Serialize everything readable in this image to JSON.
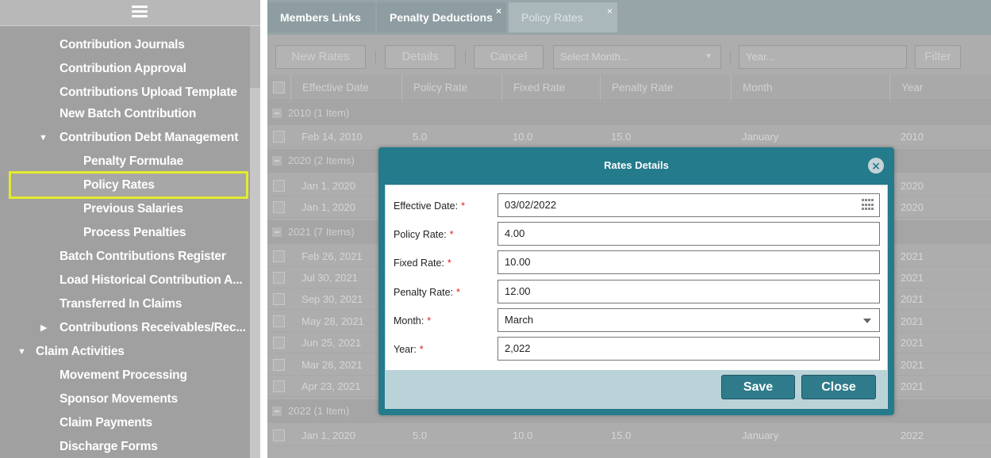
{
  "sidebar": {
    "items": [
      {
        "label": "Contribution Journals"
      },
      {
        "label": "Contribution Approval"
      },
      {
        "label": "Contributions Upload Template"
      },
      {
        "label": "New Batch Contribution"
      },
      {
        "label": "Contribution Debt Management"
      },
      {
        "label": "Penalty Formulae"
      },
      {
        "label": "Policy Rates"
      },
      {
        "label": "Previous Salaries"
      },
      {
        "label": "Process Penalties"
      },
      {
        "label": "Batch Contributions Register"
      },
      {
        "label": "Load Historical Contribution A..."
      },
      {
        "label": "Transferred In Claims"
      },
      {
        "label": "Contributions Receivables/Rec..."
      },
      {
        "label": "Claim Activities"
      },
      {
        "label": "Movement Processing"
      },
      {
        "label": "Sponsor Movements"
      },
      {
        "label": "Claim Payments"
      },
      {
        "label": "Discharge Forms"
      }
    ]
  },
  "tabs": [
    {
      "label": "Members Links"
    },
    {
      "label": "Penalty Deductions",
      "close": "×"
    },
    {
      "label": "Policy Rates",
      "close": "×"
    }
  ],
  "toolbar": {
    "new_rates": "New Rates",
    "details": "Details",
    "cancel": "Cancel",
    "month_placeholder": "Select Month...",
    "year_placeholder": "Year...",
    "filter": "Filter"
  },
  "grid": {
    "columns": [
      "Effective Date",
      "Policy Rate",
      "Fixed Rate",
      "Penalty Rate",
      "Month",
      "Year"
    ],
    "groups": [
      {
        "label": "2010 (1 Item)"
      },
      {
        "label": "2020 (2 Items)"
      },
      {
        "label": "2021 (7 Items)"
      },
      {
        "label": "2022 (1 Item)"
      }
    ],
    "rows": [
      {
        "effective": "Feb 14, 2010",
        "policy": "5.0",
        "fixed": "10.0",
        "penalty": "15.0",
        "month": "January",
        "year": "2010"
      },
      {
        "effective": "Jan 1, 2020",
        "year": "2020"
      },
      {
        "effective": "Jan 1, 2020",
        "year": "2020"
      },
      {
        "effective": "Feb 26, 2021",
        "year": "2021"
      },
      {
        "effective": "Jul 30, 2021",
        "year": "2021"
      },
      {
        "effective": "Sep 30, 2021",
        "year": "2021"
      },
      {
        "effective": "May 28, 2021",
        "year": "2021"
      },
      {
        "effective": "Jun 25, 2021",
        "year": "2021"
      },
      {
        "effective": "Mar 26, 2021",
        "year": "2021"
      },
      {
        "effective": "Apr 23, 2021",
        "year": "2021"
      },
      {
        "effective": "Jan 1, 2020",
        "policy": "5.0",
        "fixed": "10.0",
        "penalty": "15.0",
        "month": "January",
        "year": "2022"
      }
    ]
  },
  "modal": {
    "title": "Rates Details",
    "close_icon": "⨯",
    "required_mark": "*",
    "fields": {
      "effective_date": {
        "label": "Effective Date:",
        "value": "03/02/2022"
      },
      "policy_rate": {
        "label": "Policy Rate:",
        "value": "4.00"
      },
      "fixed_rate": {
        "label": "Fixed Rate:",
        "value": "10.00"
      },
      "penalty_rate": {
        "label": "Penalty Rate:",
        "value": "12.00"
      },
      "month": {
        "label": "Month:",
        "value": "March"
      },
      "year": {
        "label": "Year:",
        "value": "2,022"
      }
    },
    "save": "Save",
    "close": "Close"
  },
  "colors": {
    "modal_header": "#237b8c",
    "button": "#2f7b8b",
    "highlight": "#e3ec2c",
    "required": "#e41b1b"
  }
}
